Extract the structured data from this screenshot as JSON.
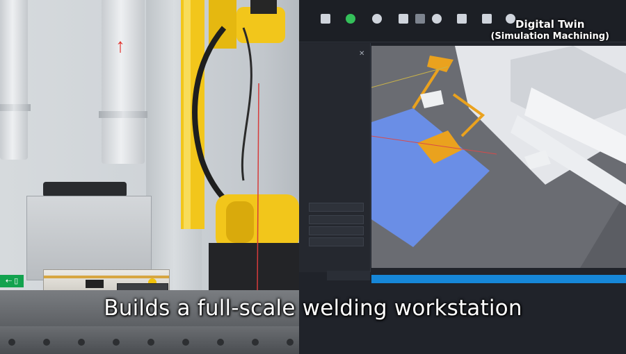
{
  "overlay": {
    "badge_line1": "Digital Twin",
    "badge_line2": "(Simulation Machining)",
    "caption": "Builds a full-scale welding workstation"
  },
  "colors": {
    "robot_yellow": "#f2c61b",
    "status_bar_blue": "#1687d8",
    "workpiece_orange": "#eaa21e",
    "plate_blue": "#6a8ee6",
    "toolbar_green": "#34c05a"
  },
  "icons": [
    "arrow-up-icon",
    "record-icon",
    "settings-icon",
    "toolbox-icon",
    "gear-icon",
    "chip-icon",
    "close-icon"
  ]
}
